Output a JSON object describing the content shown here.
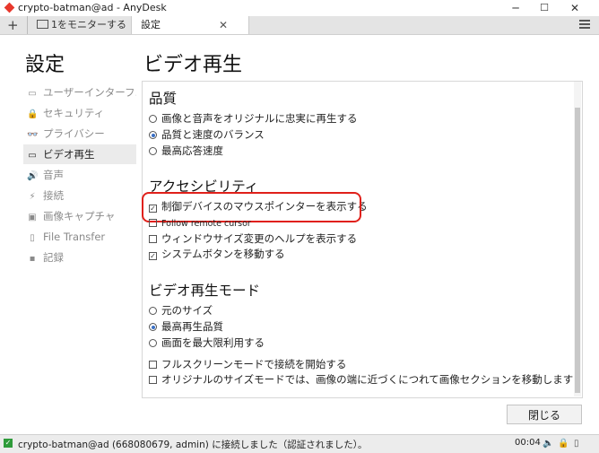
{
  "window": {
    "title": "crypto-batman@ad - AnyDesk",
    "minimize": "─",
    "maximize": "☐",
    "close": "✕"
  },
  "tabs": {
    "add": "+",
    "monitor_label": "1をモニターする",
    "settings_label": "設定",
    "settings_close": "✕"
  },
  "sidebar": {
    "title": "設定",
    "items": [
      {
        "label": "ユーザーインターフ...",
        "icon": "▭"
      },
      {
        "label": "セキュリティ",
        "icon": "🔒"
      },
      {
        "label": "プライバシー",
        "icon": "👓"
      },
      {
        "label": "ビデオ再生",
        "icon": "▭"
      },
      {
        "label": "音声",
        "icon": "🔊"
      },
      {
        "label": "接続",
        "icon": "⚡"
      },
      {
        "label": "画像キャプチャ",
        "icon": "▣"
      },
      {
        "label": "File Transfer",
        "icon": "▯"
      },
      {
        "label": "記録",
        "icon": "▪"
      }
    ],
    "active_index": 3
  },
  "main": {
    "title": "ビデオ再生",
    "quality": {
      "title": "品質",
      "options": [
        {
          "label": "画像と音声をオリジナルに忠実に再生する",
          "selected": false
        },
        {
          "label": "品質と速度のバランス",
          "selected": true
        },
        {
          "label": "最高応答速度",
          "selected": false
        }
      ]
    },
    "accessibility": {
      "title": "アクセシビリティ",
      "checks": [
        {
          "label": "制御デバイスのマウスポインターを表示する",
          "checked": true
        },
        {
          "label": "Follow remote cursor",
          "checked": false
        },
        {
          "label": "ウィンドウサイズ変更のヘルプを表示する",
          "checked": false
        },
        {
          "label": "システムボタンを移動する",
          "checked": true
        }
      ]
    },
    "mode": {
      "title": "ビデオ再生モード",
      "options": [
        {
          "label": "元のサイズ",
          "selected": false
        },
        {
          "label": "最高再生品質",
          "selected": true
        },
        {
          "label": "画面を最大限利用する",
          "selected": false
        }
      ],
      "checks": [
        {
          "label": "フルスクリーンモードで接続を開始する",
          "checked": false
        },
        {
          "label": "オリジナルのサイズモードでは、画像の端に近づくにつれて画像セクションを移動します",
          "checked": false
        }
      ]
    },
    "close_button": "閉じる"
  },
  "status": {
    "message": "crypto-batman@ad (668080679, admin) に接続しました（認証されました）。",
    "time": "00:04"
  },
  "colors": {
    "highlight": "#e0201a",
    "radio_selected": "#3a6fc4",
    "status_ok": "#2e9b3a"
  }
}
